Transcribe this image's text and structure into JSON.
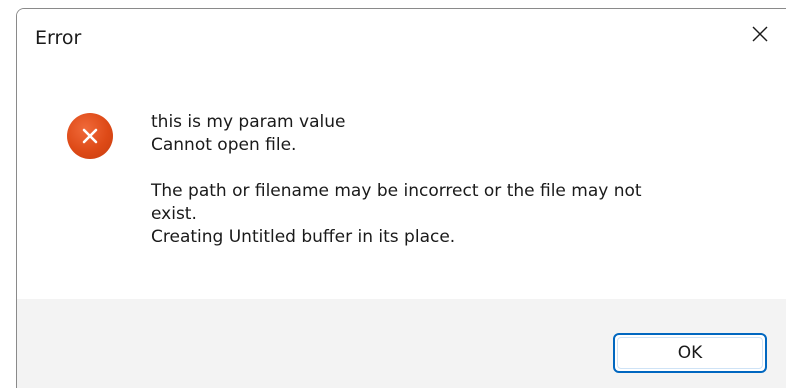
{
  "dialog": {
    "title": "Error",
    "icon": "error-icon",
    "message": {
      "line1": "this is my param value",
      "line2": "Cannot open file.",
      "line3": "The path or filename may be incorrect or the file may not",
      "line4": "exist.",
      "line5": "Creating Untitled buffer in its place."
    },
    "ok_label": "OK"
  },
  "colors": {
    "accent": "#0067c0",
    "error": "#de4a17",
    "footer_bg": "#f3f3f3"
  }
}
